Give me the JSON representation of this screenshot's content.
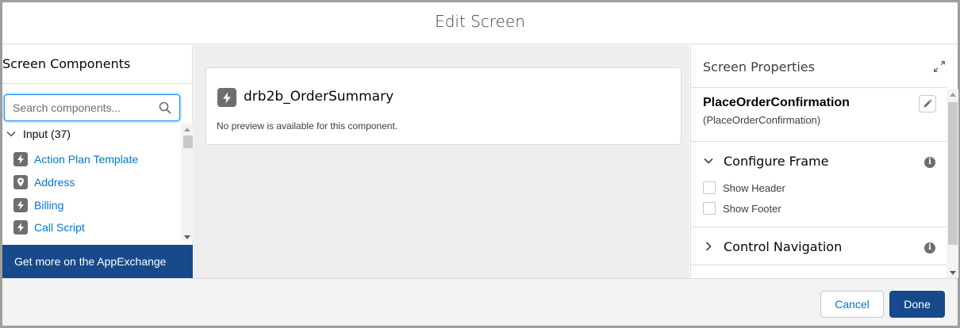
{
  "modal": {
    "title": "Edit Screen"
  },
  "components_panel": {
    "title": "Screen Components",
    "search": {
      "placeholder": "Search components...",
      "value": ""
    },
    "group": {
      "label": "Input (37)"
    },
    "items": [
      {
        "label": "Action Plan Template",
        "icon": "bolt-icon"
      },
      {
        "label": "Address",
        "icon": "location-pin-icon"
      },
      {
        "label": "Billing",
        "icon": "bolt-icon"
      },
      {
        "label": "Call Script",
        "icon": "bolt-icon"
      }
    ],
    "appexchange_label": "Get more on the AppExchange"
  },
  "canvas": {
    "component": {
      "name": "drb2b_OrderSummary",
      "icon": "bolt-icon",
      "note": "No preview is available for this component."
    }
  },
  "properties_panel": {
    "title": "Screen Properties",
    "screen_label": "PlaceOrderConfirmation",
    "screen_api_name": "(PlaceOrderConfirmation)",
    "configure_frame": {
      "label": "Configure Frame",
      "expanded": true,
      "options": [
        {
          "label": "Show Header",
          "checked": false
        },
        {
          "label": "Show Footer",
          "checked": false
        }
      ]
    },
    "control_navigation": {
      "label": "Control Navigation",
      "expanded": false
    }
  },
  "footer": {
    "cancel_label": "Cancel",
    "done_label": "Done"
  },
  "colors": {
    "brand": "#174a8b",
    "link": "#0176d3",
    "focus": "#1b96ff",
    "icon_gray": "#706e6b"
  }
}
